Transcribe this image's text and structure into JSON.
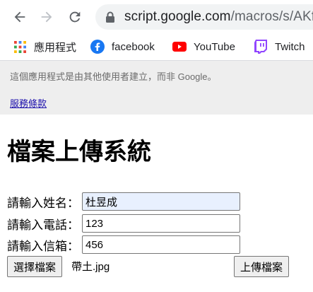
{
  "browser": {
    "url_host": "script.google.com",
    "url_path": "/macros/s/AKf",
    "icons": [
      "back-arrow-icon",
      "forward-arrow-icon",
      "reload-icon",
      "lock-icon"
    ]
  },
  "bookmarks": [
    {
      "label": "應用程式",
      "icon": "apps-grid-icon"
    },
    {
      "label": "facebook",
      "icon": "facebook-icon",
      "color": "#1877f2"
    },
    {
      "label": "YouTube",
      "icon": "youtube-icon",
      "color": "#ff0000"
    },
    {
      "label": "Twitch",
      "icon": "twitch-icon",
      "color": "#9146ff"
    }
  ],
  "banner": {
    "notice": "這個應用程式是由其他使用者建立，而非 Google。",
    "link": "服務條款"
  },
  "form": {
    "title": "檔案上傳系統",
    "name_label": "請輸入姓名：",
    "name_value": "杜昱成",
    "phone_label": "請輸入電話：",
    "phone_value": "123",
    "email_label": "請輸入信箱：",
    "email_value": "456",
    "choose_button": "選擇檔案",
    "file_name": "帶土.jpg",
    "upload_button": "上傳檔案"
  },
  "colors": {
    "autofill_bg": "#e8f0fe",
    "banner_bg": "#eeeeee",
    "link": "#1a0dab"
  }
}
